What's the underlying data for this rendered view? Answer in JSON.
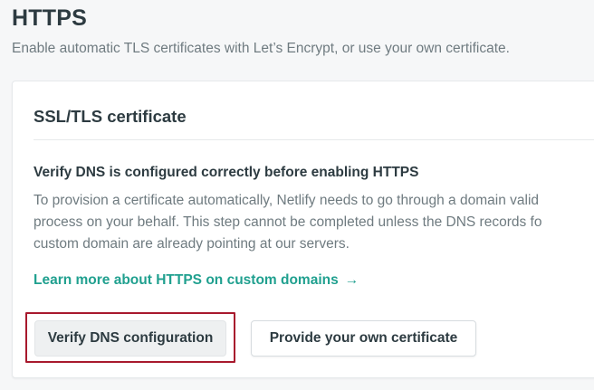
{
  "section": {
    "title": "HTTPS",
    "description": "Enable automatic TLS certificates with Let’s Encrypt, or use your own certificate."
  },
  "card": {
    "title": "SSL/TLS certificate",
    "notice": {
      "title": "Verify DNS is configured correctly before enabling HTTPS",
      "body_lines": [
        "To provision a certificate automatically, Netlify needs to go through a domain valid",
        "process on your behalf. This step cannot be completed unless the DNS records fo",
        "custom domain are already pointing at our servers."
      ]
    },
    "link": {
      "label": "Learn more about HTTPS on custom domains",
      "arrow": "→",
      "color": "#20a08f"
    },
    "buttons": {
      "verify_label": "Verify DNS configuration",
      "provide_label": "Provide your own certificate"
    }
  },
  "highlight_color": "#a8192d"
}
